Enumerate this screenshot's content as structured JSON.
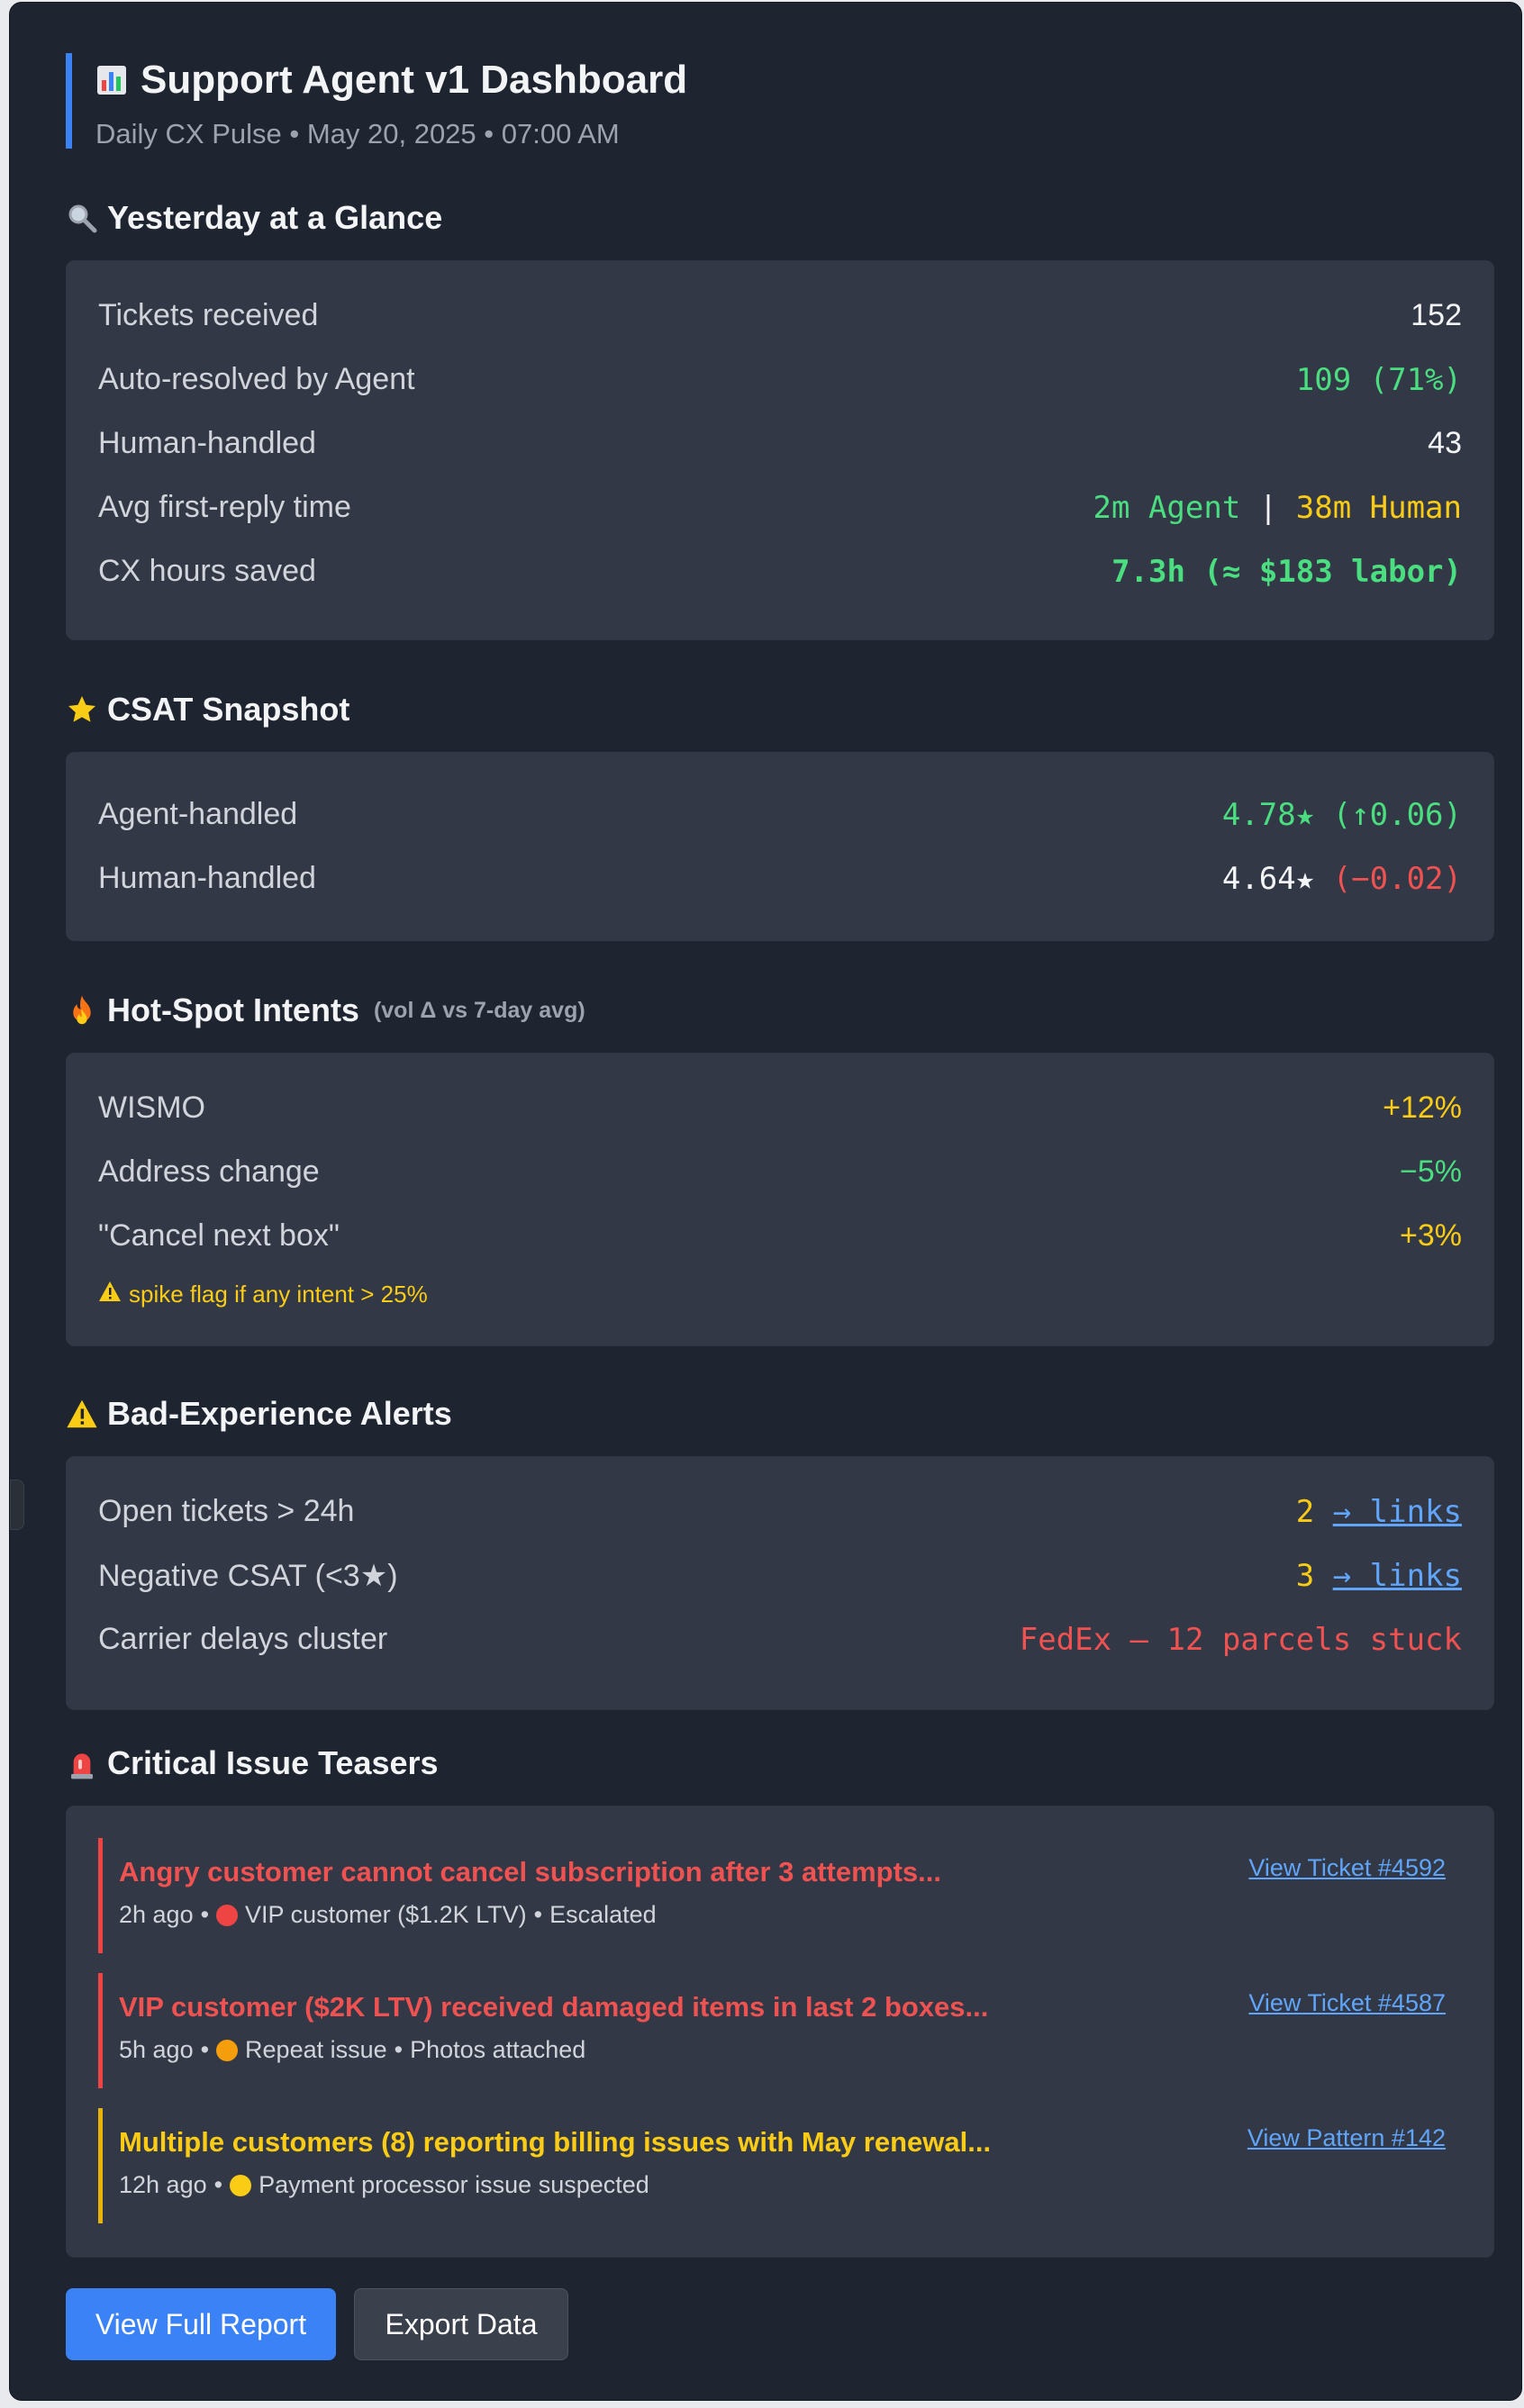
{
  "header": {
    "icon": "bar-chart-icon",
    "title": "Support Agent v1 Dashboard",
    "subtitle": "Daily CX Pulse • May 20, 2025 • 07:00 AM"
  },
  "glance": {
    "icon": "magnifier-icon",
    "title": "Yesterday at a Glance",
    "rows": [
      {
        "label": "Tickets received",
        "value": "152"
      },
      {
        "label": "Auto-resolved by Agent",
        "value": "109 (71%)"
      },
      {
        "label": "Human-handled",
        "value": "43"
      },
      {
        "label": "Avg first-reply time",
        "value_agent": "2m Agent",
        "sep": "|",
        "value_human": "38m Human"
      },
      {
        "label": "CX hours saved",
        "value": "7.3h (≈ $183 labor)"
      }
    ]
  },
  "csat": {
    "icon": "star-icon",
    "title": "CSAT Snapshot",
    "rows": [
      {
        "label": "Agent-handled",
        "score": "4.78★",
        "delta": "(↑0.06)"
      },
      {
        "label": "Human-handled",
        "score": "4.64★",
        "delta": "(−0.02)"
      }
    ]
  },
  "hotspot": {
    "icon": "fire-icon",
    "title": "Hot-Spot Intents",
    "subtitle": "(vol Δ vs 7-day avg)",
    "rows": [
      {
        "label": "WISMO",
        "value": "+12%"
      },
      {
        "label": "Address change",
        "value": "−5%"
      },
      {
        "label": "\"Cancel next box\"",
        "value": "+3%"
      }
    ],
    "note": "spike flag if any intent > 25%"
  },
  "alerts": {
    "icon": "warning-icon",
    "title": "Bad-Experience Alerts",
    "rows": [
      {
        "label": "Open tickets > 24h",
        "count": "2",
        "link": "→ links"
      },
      {
        "label": "Negative CSAT (<3★)",
        "count": "3",
        "link": "→ links"
      },
      {
        "label": "Carrier delays cluster",
        "value": "FedEx — 12 parcels stuck"
      }
    ]
  },
  "critical": {
    "icon": "siren-icon",
    "title": "Critical Issue Teasers",
    "items": [
      {
        "title": "Angry customer cannot cancel subscription after 3 attempts...",
        "time": "2h ago",
        "tag": "VIP customer ($1.2K LTV)",
        "extra": "Escalated",
        "link": "View Ticket #4592"
      },
      {
        "title": "VIP customer ($2K LTV) received damaged items in last 2 boxes...",
        "time": "5h ago",
        "tag": "Repeat issue",
        "extra": "Photos attached",
        "link": "View Ticket #4587"
      },
      {
        "title": "Multiple customers (8) reporting billing issues with May renewal...",
        "time": "12h ago",
        "tag": "Payment processor issue suspected",
        "link": "View Pattern #142"
      }
    ]
  },
  "buttons": {
    "full_report": "View Full Report",
    "export": "Export Data"
  },
  "colors": {
    "accent": "#3b82f6",
    "green": "#4ade80",
    "yellow": "#facc15",
    "red": "#f05252",
    "card": "#323846",
    "background": "#1f2530"
  }
}
